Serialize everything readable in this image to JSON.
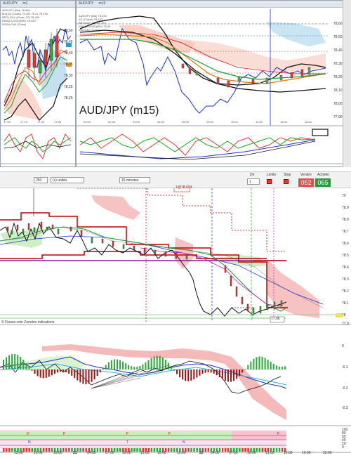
{
  "windows": {
    "left": {
      "title": "AUD/JPY",
      "tab2": "m1",
      "legend": [
        "AUD/JPY (Bid) 78,480",
        "MA(10) (Close) 78,432 78,41 78,430",
        "BROLIGH/ (Close, 20) 78,430",
        "EMA(CLOSE)(BID) 78,430",
        "WOOLOWI (Close)"
      ],
      "price_labels": [
        "78,50",
        "78,45",
        "78,40",
        "78,35",
        "78,30",
        "78,25",
        "78,20",
        "78,15"
      ],
      "time_labels": [
        "17:00",
        "17:15",
        "17:30",
        "17:45"
      ]
    },
    "right": {
      "title": "AUD/JPY",
      "tab2": "m15",
      "big_label": "AUD/JPY (m15)",
      "legend": [
        "AUD/JPY (Bid) 78,430",
        "AS (Chaos) 78,433",
        "BROLIGH (Close, 20)",
        "EMA(CLOSE)(BID) 78,44",
        "Ichimoku (Close)"
      ],
      "price_labels": [
        "78,60",
        "78,50",
        "78,40",
        "78,30",
        "78,20",
        "78,10",
        "78,00",
        "77,90"
      ],
      "time_labels": [
        "00:00",
        "02:00",
        "04:00",
        "06:00",
        "08:00",
        "10:00",
        "12:00",
        "14:00",
        "16:00",
        "18:00"
      ]
    }
  },
  "controls": {
    "quantity": "250",
    "unit": "(x) unités",
    "timeframe": "15 minutes",
    "dir_label": "Dir",
    "limit_label": "Limite",
    "stop_label": "Stop",
    "sell_label": "Vendre",
    "buy_label": "Acheter",
    "sell_price": "052",
    "buy_price": "065",
    "stop_value": "1"
  },
  "main_chart": {
    "y_labels": [
      "79",
      "78.9",
      "78.8",
      "78.7",
      "78.6",
      "78.5",
      "78.4",
      "78.3",
      "78.2",
      "78.1",
      "78",
      "77.9"
    ],
    "annotation_top": "1@78,434",
    "annotation_bottom": "77,96",
    "credit": "© Fiance.com Zonetes indications"
  },
  "osc_panel": {
    "y_labels": [
      "0",
      "-0.1",
      "-0.2",
      "-0.3"
    ]
  },
  "bottom_panel": {
    "y_labels": [
      "100",
      "80",
      "60",
      "40",
      "20",
      "0"
    ],
    "markers": [
      "V",
      "F",
      "F",
      "F",
      "F",
      "N",
      "T",
      "N"
    ]
  },
  "x_axis": {
    "labels": [
      "13:00",
      "16:00",
      "19:00",
      "21",
      "04:00",
      "07:00",
      "10:00",
      "13:00",
      "16:00",
      "19:00",
      "22",
      "04:00",
      "07:00",
      "10:00",
      "13:00",
      "16:00",
      "19:00",
      "22:00"
    ]
  },
  "colors": {
    "sell": "#d9534f",
    "buy": "#2e9a3c",
    "window_bar": "#dfe6ee",
    "accent": "#c00000"
  }
}
